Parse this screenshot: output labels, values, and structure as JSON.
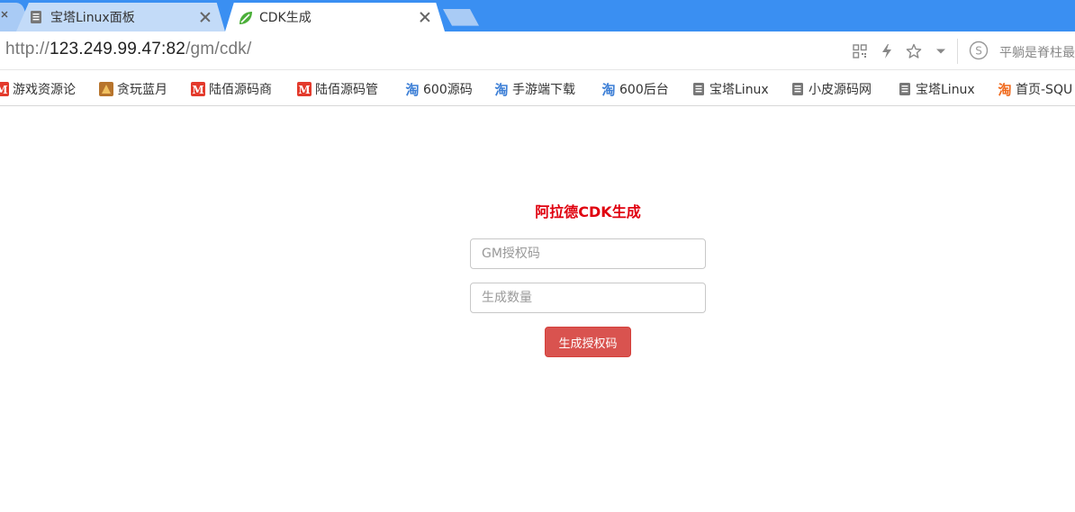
{
  "browser": {
    "tabs": [
      {
        "title": "宝塔Linux面板",
        "icon": "document-icon",
        "active": false
      },
      {
        "title": "CDK生成",
        "icon": "leaf-icon",
        "active": true
      }
    ],
    "url": {
      "scheme": "http://",
      "host": "123.249.99.47:82",
      "path": "/gm/cdk/"
    },
    "search_box_text": "平躺是脊柱最"
  },
  "bookmarks": [
    {
      "label": "游戏资源论",
      "icon": "m-red-icon"
    },
    {
      "label": "贪玩蓝月",
      "icon": "game-icon"
    },
    {
      "label": "陆佰源码商",
      "icon": "m-red-icon"
    },
    {
      "label": "陆佰源码管",
      "icon": "m-red-icon"
    },
    {
      "label": "600源码",
      "icon": "taobao-icon"
    },
    {
      "label": "手游端下载",
      "icon": "taobao-icon"
    },
    {
      "label": "600后台",
      "icon": "taobao-icon"
    },
    {
      "label": "宝塔Linux",
      "icon": "document-icon"
    },
    {
      "label": "小皮源码网",
      "icon": "document-icon"
    },
    {
      "label": "宝塔Linux",
      "icon": "document-icon"
    },
    {
      "label": "首页-SQU",
      "icon": "taobao-orange-icon"
    }
  ],
  "page": {
    "title": "阿拉德CDK生成",
    "gm_code_placeholder": "GM授权码",
    "quantity_placeholder": "生成数量",
    "generate_button": "生成授权码"
  },
  "colors": {
    "tabbar": "#3a8ff2",
    "title_red": "#e0000f",
    "button_red": "#d9534f"
  }
}
